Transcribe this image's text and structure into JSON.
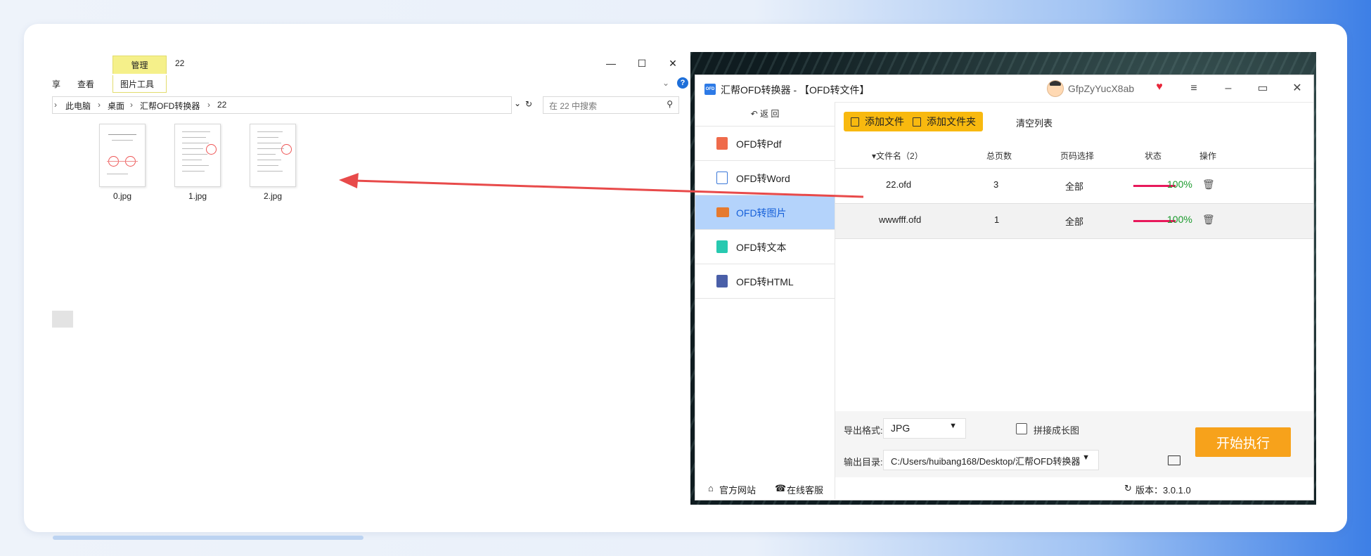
{
  "explorer": {
    "ribbon_manage_tab": "管理",
    "window_title": "22",
    "ribbon_items": [
      "享",
      "查看",
      "图片工具"
    ],
    "breadcrumb": [
      "此电脑",
      "桌面",
      "汇帮OFD转换器",
      "22"
    ],
    "search_placeholder": "在 22 中搜索",
    "files": [
      {
        "name": "0.jpg"
      },
      {
        "name": "1.jpg"
      },
      {
        "name": "2.jpg"
      }
    ],
    "help_glyph": "?"
  },
  "app": {
    "title": "汇帮OFD转换器 - 【OFD转文件】",
    "logo_text": "OFD",
    "username": "GfpZyYucX8ab",
    "back_label": "返 回",
    "nav": [
      {
        "label": "OFD转Pdf",
        "color": "#ef6b4b"
      },
      {
        "label": "OFD转Word",
        "color": "#3b78d8"
      },
      {
        "label": "OFD转图片",
        "color": "#e67a2e",
        "active": true
      },
      {
        "label": "OFD转文本",
        "color": "#27c9b0"
      },
      {
        "label": "OFD转HTML",
        "color": "#4a5fa8"
      }
    ],
    "toolbar": {
      "add_file": "添加文件",
      "add_folder": "添加文件夹",
      "clear_list": "清空列表"
    },
    "table": {
      "headers": {
        "filename": "▾文件名（2）",
        "pages": "总页数",
        "page_select": "页码选择",
        "status": "状态",
        "action": "操作"
      },
      "rows": [
        {
          "filename": "22.ofd",
          "pages": "3",
          "page_select": "全部",
          "progress": "100%"
        },
        {
          "filename": "wwwfff.ofd",
          "pages": "1",
          "page_select": "全部",
          "progress": "100%"
        }
      ]
    },
    "export": {
      "format_label": "导出格式:",
      "format_value": "JPG",
      "merge_label": "拼接成长图",
      "output_label": "输出目录:",
      "output_value": "C:/Users/huibang168/Desktop/汇帮OFD转换器",
      "start_button": "开始执行"
    },
    "footer": {
      "website": "官方网站",
      "support": "在线客服",
      "version": "版本：3.0.1.0"
    },
    "colors": {
      "accent_yellow": "#f8b90f",
      "start_orange": "#f7a21b",
      "progress": "#e8195b",
      "percent_green": "#1a9a2c",
      "active_nav": "#b4d3fb"
    }
  }
}
